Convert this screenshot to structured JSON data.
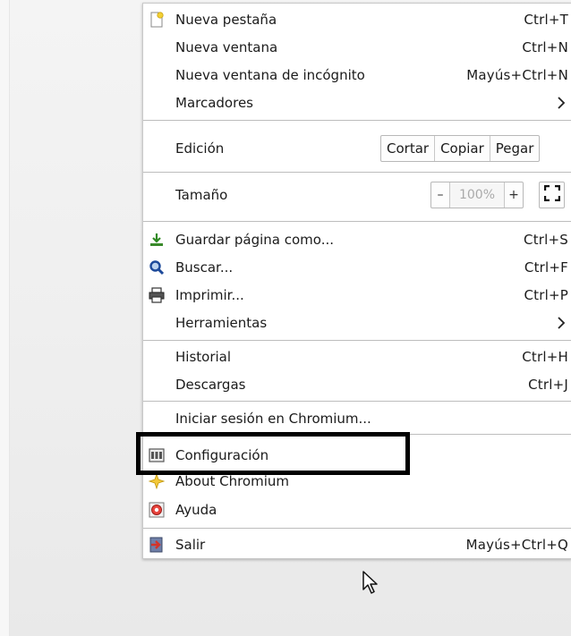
{
  "menu": {
    "new_tab": {
      "label": "Nueva pestaña",
      "accel": "Ctrl+T",
      "icon": "new-tab-icon"
    },
    "new_window": {
      "label": "Nueva ventana",
      "accel": "Ctrl+N"
    },
    "incognito": {
      "label": "Nueva ventana de incógnito",
      "accel": "Mayús+Ctrl+N"
    },
    "bookmarks": {
      "label": "Marcadores",
      "icon": "chevron-right-icon"
    },
    "edit": {
      "label": "Edición",
      "cut": "Cortar",
      "copy": "Copiar",
      "paste": "Pegar"
    },
    "zoom": {
      "label": "Tamaño",
      "minus": "–",
      "value": "100%",
      "plus": "+",
      "icon": "fullscreen-icon"
    },
    "save_page": {
      "label": "Guardar página como...",
      "accel": "Ctrl+S",
      "icon": "save-icon"
    },
    "find": {
      "label": "Buscar...",
      "accel": "Ctrl+F",
      "icon": "magnifier-icon"
    },
    "print": {
      "label": "Imprimir...",
      "accel": "Ctrl+P",
      "icon": "printer-icon"
    },
    "tools": {
      "label": "Herramientas",
      "icon": "chevron-right-icon"
    },
    "history": {
      "label": "Historial",
      "accel": "Ctrl+H"
    },
    "downloads": {
      "label": "Descargas",
      "accel": "Ctrl+J"
    },
    "sign_in": {
      "label": "Iniciar sesión en Chromium..."
    },
    "settings": {
      "label": "Configuración",
      "icon": "settings-icon"
    },
    "about": {
      "label": "About Chromium",
      "icon": "star-icon"
    },
    "help": {
      "label": "Ayuda",
      "icon": "help-icon"
    },
    "exit": {
      "label": "Salir",
      "accel": "Mayús+Ctrl+Q",
      "icon": "exit-icon"
    }
  },
  "colors": {
    "highlight_border": "#000000",
    "menu_bg": "#ffffff",
    "separator": "#bdbdbd"
  }
}
